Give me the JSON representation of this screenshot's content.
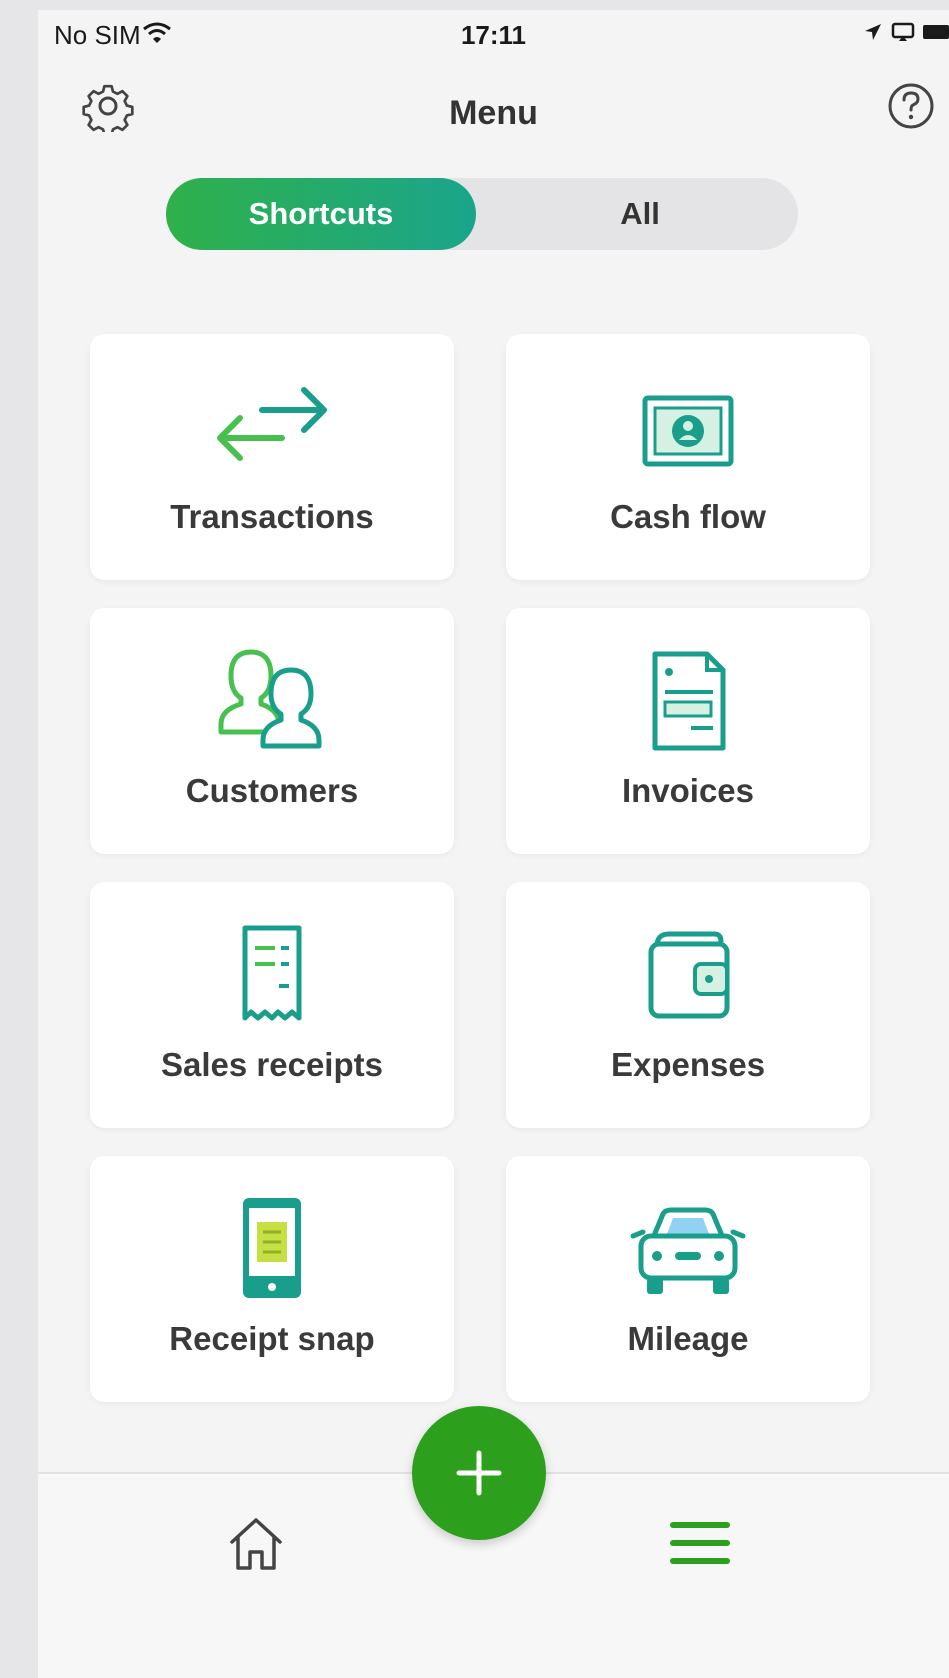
{
  "status_bar": {
    "carrier": "No SIM",
    "time": "17:11"
  },
  "header": {
    "title": "Menu",
    "settings_icon": "gear-icon",
    "help_icon": "question-circle-icon"
  },
  "segmented_control": {
    "options": [
      "Shortcuts",
      "All"
    ],
    "selected": "Shortcuts"
  },
  "shortcuts": [
    {
      "label": "Transactions",
      "icon": "transactions-arrows-icon"
    },
    {
      "label": "Cash flow",
      "icon": "cash-icon"
    },
    {
      "label": "Customers",
      "icon": "customers-icon"
    },
    {
      "label": "Invoices",
      "icon": "invoice-icon"
    },
    {
      "label": "Sales receipts",
      "icon": "receipt-icon"
    },
    {
      "label": "Expenses",
      "icon": "wallet-icon"
    },
    {
      "label": "Receipt snap",
      "icon": "phone-receipt-icon"
    },
    {
      "label": "Mileage",
      "icon": "car-icon"
    }
  ],
  "tab_bar": {
    "items": [
      "home-icon",
      "menu-icon"
    ],
    "fab_icon": "plus-icon"
  },
  "colors": {
    "accent": "#2ca01c",
    "teal": "#1a9e8c",
    "green": "#47c04f",
    "background": "#f4f4f5"
  }
}
